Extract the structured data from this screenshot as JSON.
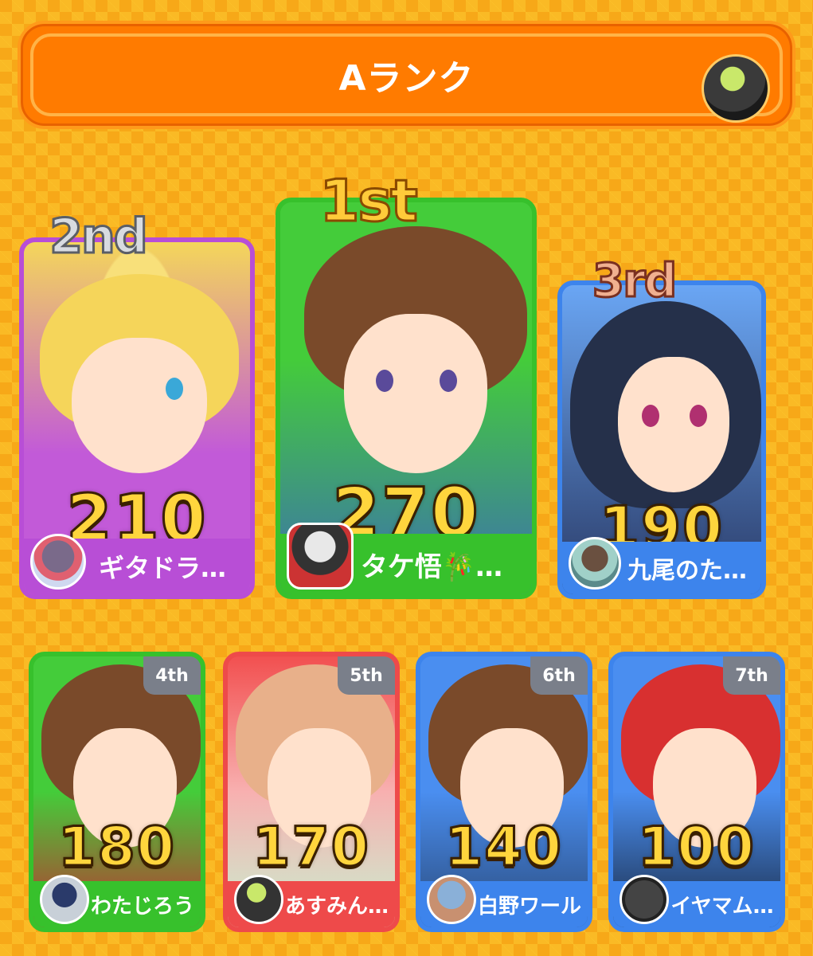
{
  "header": {
    "title": "Aランク"
  },
  "podium": [
    {
      "rank_label": "2nd",
      "score": "210",
      "name": "ギタドラ…",
      "card_color": "#c25ad8",
      "name_bar_color": "#b84ed6",
      "badge_color": "silver"
    },
    {
      "rank_label": "1st",
      "score": "270",
      "name": "タケ悟🎋…",
      "card_color": "#44cc3a",
      "name_bar_color": "#37c12c",
      "badge_color": "gold"
    },
    {
      "rank_label": "3rd",
      "score": "190",
      "name": "九尾のた…",
      "card_color": "#4a8ef0",
      "name_bar_color": "#3d84ec",
      "badge_color": "bronze"
    }
  ],
  "others": [
    {
      "rank_label": "4th",
      "score": "180",
      "name": "わたじろう",
      "card_color": "#44cc3a"
    },
    {
      "rank_label": "5th",
      "score": "170",
      "name": "あすみん…",
      "card_color": "#f25050"
    },
    {
      "rank_label": "6th",
      "score": "140",
      "name": "白野ワール",
      "card_color": "#4a8ef0"
    },
    {
      "rank_label": "7th",
      "score": "100",
      "name": "イヤマム…",
      "card_color": "#4a8ef0"
    }
  ]
}
